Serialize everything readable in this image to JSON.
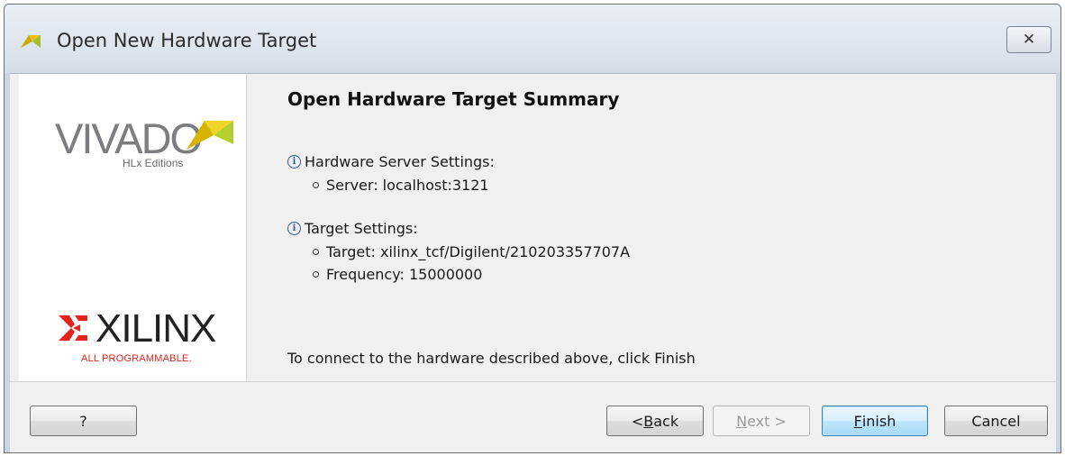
{
  "window": {
    "title": "Open New Hardware Target",
    "close_glyph": "✕"
  },
  "branding": {
    "vivado_word": "VIVADO",
    "vivado_sub": "HLx Editions",
    "xilinx_word": "XILINX",
    "xilinx_sub": "ALL PROGRAMMABLE."
  },
  "summary": {
    "heading": "Open Hardware Target Summary",
    "sections": [
      {
        "title": "Hardware Server Settings:",
        "items": [
          "Server: localhost:3121"
        ]
      },
      {
        "title": "Target Settings:",
        "items": [
          "Target: xilinx_tcf/Digilent/210203357707A",
          "Frequency: 15000000"
        ]
      }
    ],
    "footer": "To connect to the hardware described above, click Finish"
  },
  "buttons": {
    "help": "?",
    "back_prefix": "< ",
    "back_mnemonic": "B",
    "back_rest": "ack",
    "next_mnemonic": "N",
    "next_rest": "ext >",
    "finish_mnemonic": "F",
    "finish_rest": "inish",
    "cancel": "Cancel"
  },
  "colors": {
    "accent_yellow": "#e8c21a",
    "xilinx_red": "#e3231c",
    "info_blue": "#2c5f9e"
  }
}
